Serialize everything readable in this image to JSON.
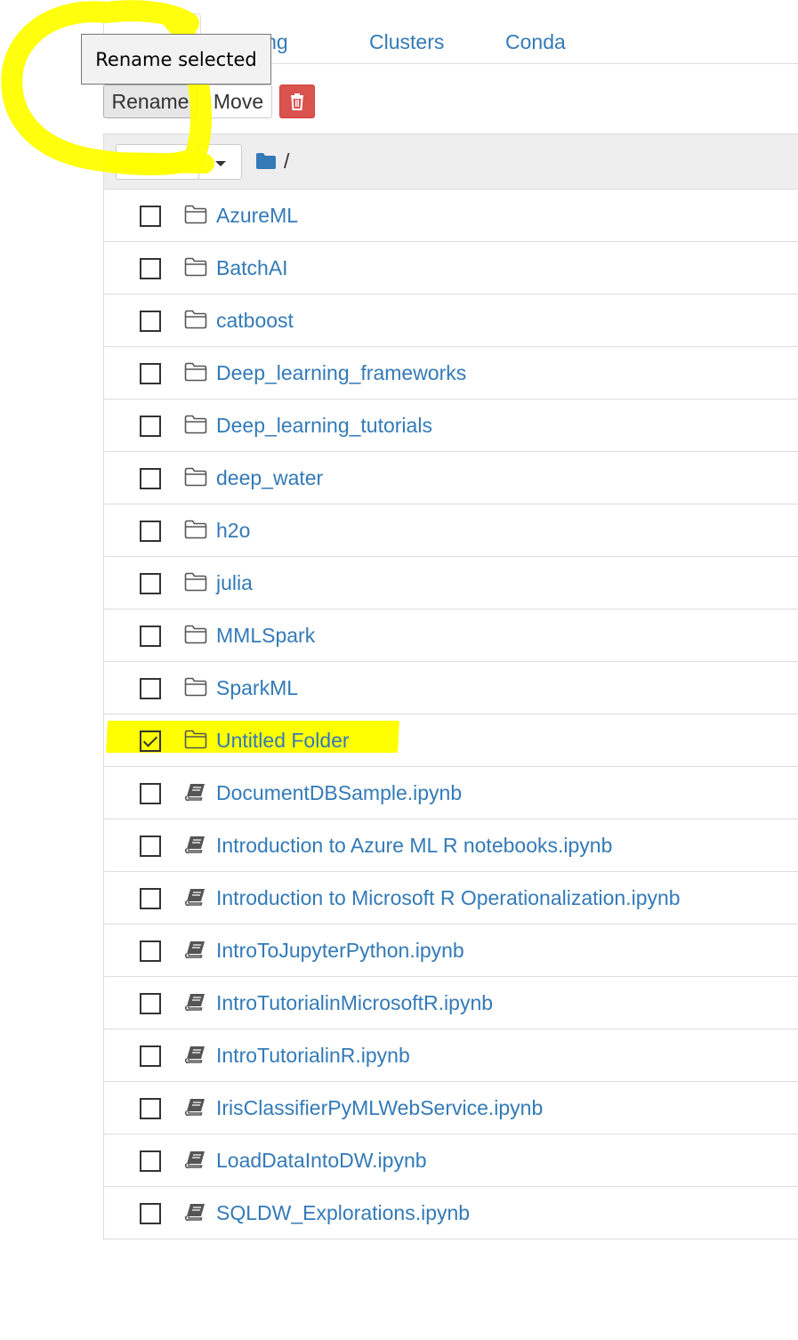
{
  "tabs": {
    "running": "Running",
    "clusters": "Clusters",
    "conda": "Conda"
  },
  "toolbar": {
    "rename_label": "Rename",
    "move_label": "Move",
    "delete_icon": "trash-icon",
    "delete_color": "#d9534f"
  },
  "tooltip": {
    "text": "Rename selected"
  },
  "list": {
    "selected_count": "1",
    "breadcrumb_sep": "/",
    "items": [
      {
        "name": "AzureML",
        "type": "folder",
        "checked": false
      },
      {
        "name": "BatchAI",
        "type": "folder",
        "checked": false
      },
      {
        "name": "catboost",
        "type": "folder",
        "checked": false
      },
      {
        "name": "Deep_learning_frameworks",
        "type": "folder",
        "checked": false
      },
      {
        "name": "Deep_learning_tutorials",
        "type": "folder",
        "checked": false
      },
      {
        "name": "deep_water",
        "type": "folder",
        "checked": false
      },
      {
        "name": "h2o",
        "type": "folder",
        "checked": false
      },
      {
        "name": "julia",
        "type": "folder",
        "checked": false
      },
      {
        "name": "MMLSpark",
        "type": "folder",
        "checked": false
      },
      {
        "name": "SparkML",
        "type": "folder",
        "checked": false
      },
      {
        "name": "Untitled Folder",
        "type": "folder",
        "checked": true
      },
      {
        "name": "DocumentDBSample.ipynb",
        "type": "notebook",
        "checked": false
      },
      {
        "name": "Introduction to Azure ML R notebooks.ipynb",
        "type": "notebook",
        "checked": false
      },
      {
        "name": "Introduction to Microsoft R Operationalization.ipynb",
        "type": "notebook",
        "checked": false
      },
      {
        "name": "IntroToJupyterPython.ipynb",
        "type": "notebook",
        "checked": false
      },
      {
        "name": "IntroTutorialinMicrosoftR.ipynb",
        "type": "notebook",
        "checked": false
      },
      {
        "name": "IntroTutorialinR.ipynb",
        "type": "notebook",
        "checked": false
      },
      {
        "name": "IrisClassifierPyMLWebService.ipynb",
        "type": "notebook",
        "checked": false
      },
      {
        "name": "LoadDataIntoDW.ipynb",
        "type": "notebook",
        "checked": false
      },
      {
        "name": "SQLDW_Explorations.ipynb",
        "type": "notebook",
        "checked": false
      }
    ]
  },
  "colors": {
    "link": "#337ab7",
    "highlight": "#ffff00"
  }
}
